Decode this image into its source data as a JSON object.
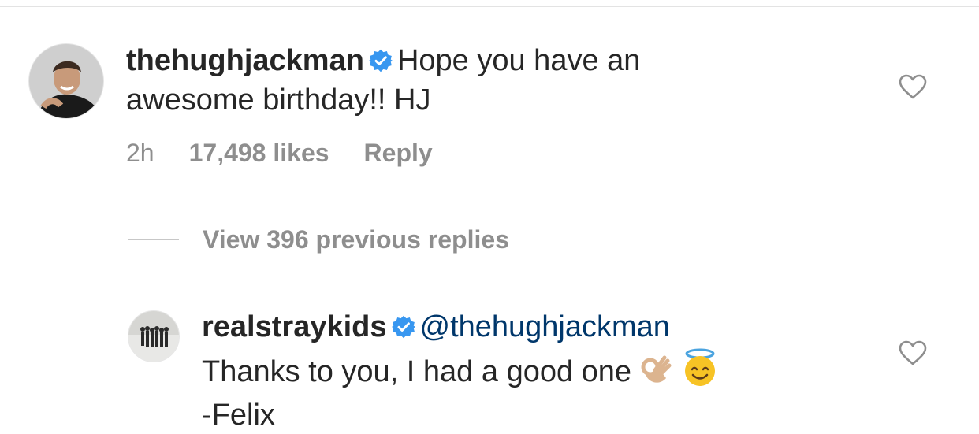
{
  "comment": {
    "username": "thehughjackman",
    "verified": true,
    "text_line1": "Hope you have an",
    "text_line2": "awesome birthday!! HJ",
    "time": "2h",
    "likes": "17,498 likes",
    "reply_label": "Reply",
    "heart_icon": "heart-outline-icon"
  },
  "view_replies": "View 396 previous replies",
  "reply": {
    "username": "realstraykids",
    "verified": true,
    "mention": "@thehughjackman",
    "text_line2": "Thanks to you, I had a good one",
    "text_line3": "-Felix",
    "emoji": [
      "ok-hand-emoji",
      "smiling-face-with-halo-emoji"
    ],
    "heart_icon": "heart-outline-icon"
  },
  "colors": {
    "text": "#262626",
    "secondary": "#8e8e8e",
    "mention": "#00376b",
    "verified": "#3897f0"
  }
}
